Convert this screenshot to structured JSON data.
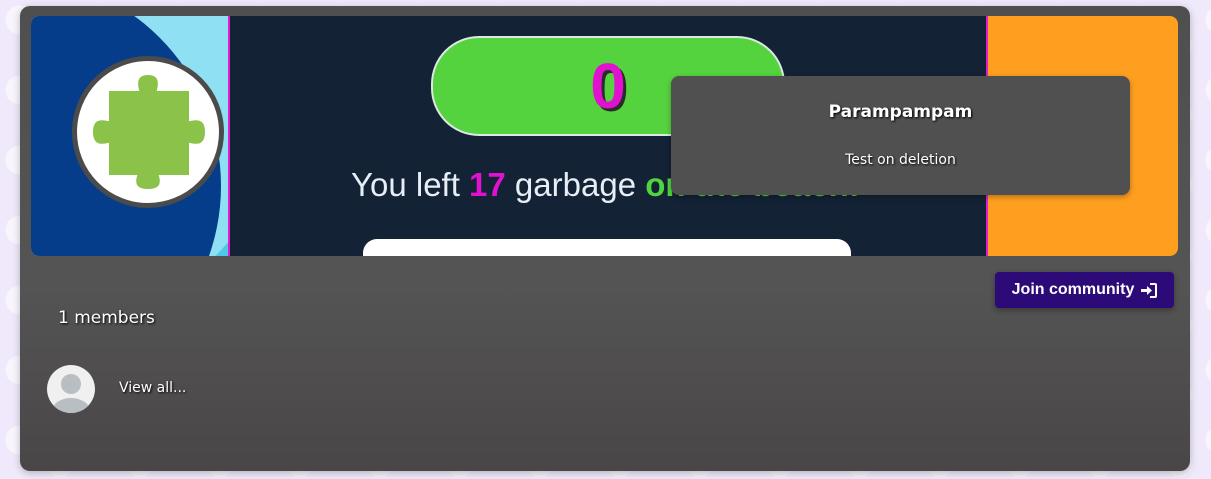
{
  "banner": {
    "score": "0",
    "message_prefix": "You left ",
    "message_count": "17",
    "message_middle": " garbage ",
    "message_tail": "on the beach!"
  },
  "tooltip": {
    "title": "Parampampam",
    "description": "Test on deletion"
  },
  "community": {
    "join_label": "Join community",
    "join_icon": "sign-in-icon",
    "members_label": "1 members",
    "view_all_label": "View all..."
  },
  "colors": {
    "accent": "#2c0a78",
    "score": "#e012cf",
    "pill": "#55d33e",
    "orange": "#ff9f1f"
  }
}
